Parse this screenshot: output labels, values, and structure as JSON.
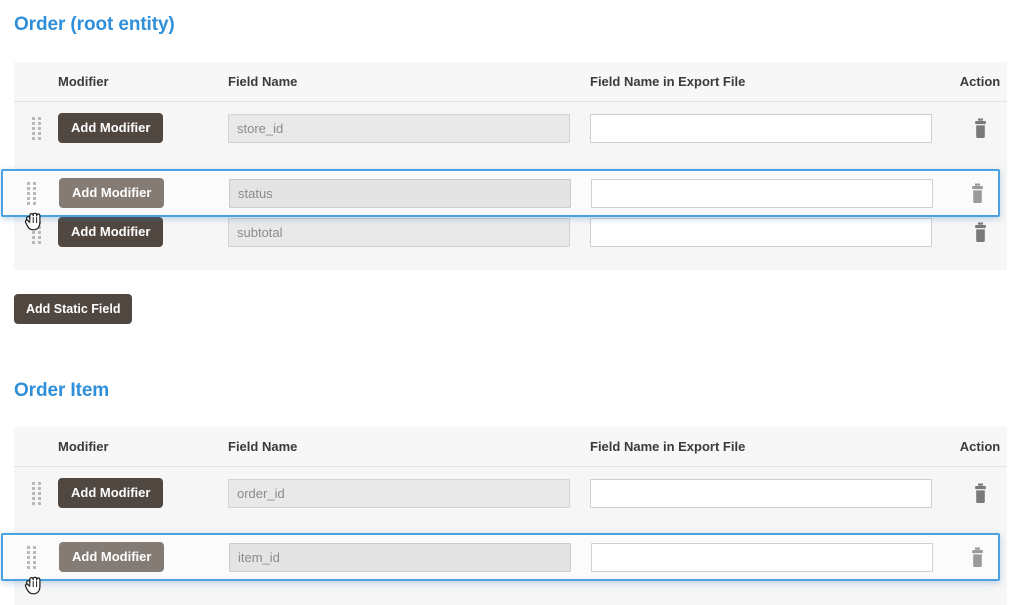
{
  "theme": {
    "heading_color": "#2f8fd9",
    "button_color": "#514741",
    "button_ghost_color": "#847b74",
    "drag_border_color": "#4aa3e0",
    "table_bg": "#f6f6f6",
    "disabled_input_bg": "#e9e9e9"
  },
  "columns": {
    "modifier": "Modifier",
    "field_name": "Field Name",
    "field_name_export": "Field Name in Export File",
    "action": "Action"
  },
  "sections": [
    {
      "title": "Order (root entity)",
      "rows": [
        {
          "modifier_label": "Add Modifier",
          "field_name": "store_id",
          "export_name": "",
          "export_placeholder": "",
          "dragging": false
        },
        {
          "modifier_label": "Add Modifier",
          "field_name": "status",
          "export_name": "",
          "export_placeholder": "",
          "dragging": true
        },
        {
          "modifier_label": "Add Modifier",
          "field_name": "subtotal",
          "export_name": "",
          "export_placeholder": "",
          "dragging": false
        }
      ],
      "add_static_field_label": "Add Static Field"
    },
    {
      "title": "Order Item",
      "rows": [
        {
          "modifier_label": "Add Modifier",
          "field_name": "order_id",
          "export_name": "",
          "export_placeholder": "",
          "dragging": false
        },
        {
          "modifier_label": "Add Modifier",
          "field_name": "item_id",
          "export_name": "",
          "export_placeholder": "",
          "dragging": true
        }
      ],
      "add_static_field_label": null
    }
  ]
}
